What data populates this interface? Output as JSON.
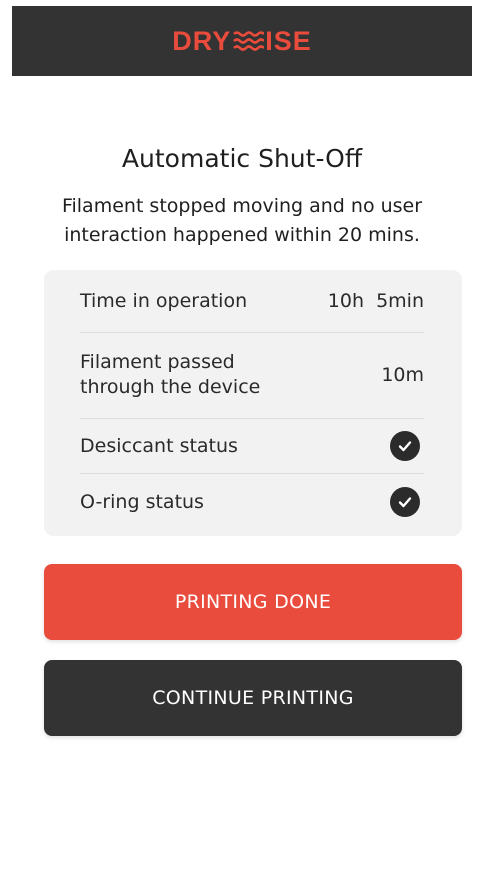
{
  "colors": {
    "brand": "#e94b3c",
    "header_bg": "#333333",
    "card_bg": "#f2f2f2",
    "primary_button": "#e94b3c",
    "secondary_button": "#333333"
  },
  "header": {
    "logo_left": "DRY",
    "logo_icon": "waves-logo-icon",
    "logo_right": "ISE"
  },
  "dialog": {
    "title": "Automatic Shut-Off",
    "message": "Filament stopped moving and no user interaction happened within 20 mins."
  },
  "stats": {
    "time_label": "Time in operation",
    "time_value": "10h  5min",
    "filament_label": "Filament passed through the device",
    "filament_value": "10m",
    "desiccant_label": "Desiccant status",
    "desiccant_icon": "check-circle-icon",
    "oring_label": "O-ring status",
    "oring_icon": "check-circle-icon"
  },
  "buttons": {
    "done_label": "PRINTING DONE",
    "continue_label": "CONTINUE PRINTING"
  }
}
